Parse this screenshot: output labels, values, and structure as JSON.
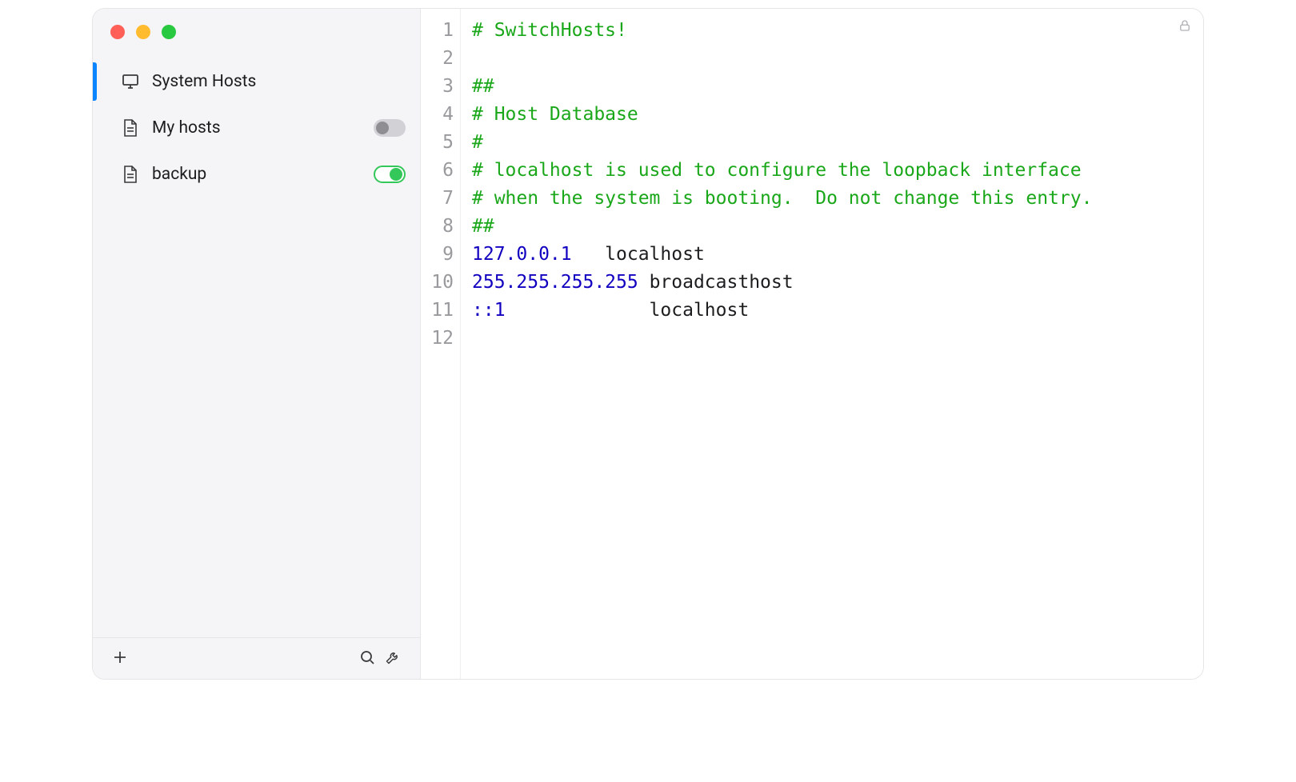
{
  "sidebar": {
    "items": [
      {
        "label": "System Hosts",
        "iconName": "monitor-icon",
        "selected": true,
        "toggle": null
      },
      {
        "label": "My hosts",
        "iconName": "file-icon",
        "selected": false,
        "toggle": "off"
      },
      {
        "label": "backup",
        "iconName": "file-icon",
        "selected": false,
        "toggle": "on"
      }
    ]
  },
  "editor": {
    "readOnly": true,
    "lines": [
      {
        "n": 1,
        "tokens": [
          {
            "t": "# SwitchHosts!",
            "c": "cm-comment"
          }
        ]
      },
      {
        "n": 2,
        "tokens": [
          {
            "t": "",
            "c": ""
          }
        ]
      },
      {
        "n": 3,
        "tokens": [
          {
            "t": "##",
            "c": "cm-comment"
          }
        ]
      },
      {
        "n": 4,
        "tokens": [
          {
            "t": "# Host Database",
            "c": "cm-comment"
          }
        ]
      },
      {
        "n": 5,
        "tokens": [
          {
            "t": "#",
            "c": "cm-comment"
          }
        ]
      },
      {
        "n": 6,
        "tokens": [
          {
            "t": "# localhost is used to configure the loopback interface",
            "c": "cm-comment"
          }
        ]
      },
      {
        "n": 7,
        "tokens": [
          {
            "t": "# when the system is booting.  Do not change this entry.",
            "c": "cm-comment"
          }
        ]
      },
      {
        "n": 8,
        "tokens": [
          {
            "t": "##",
            "c": "cm-comment"
          }
        ]
      },
      {
        "n": 9,
        "tokens": [
          {
            "t": "127.0.0.1",
            "c": "cm-ip"
          },
          {
            "t": "   localhost",
            "c": ""
          }
        ]
      },
      {
        "n": 10,
        "tokens": [
          {
            "t": "255.255.255.255",
            "c": "cm-ip"
          },
          {
            "t": " broadcasthost",
            "c": ""
          }
        ]
      },
      {
        "n": 11,
        "tokens": [
          {
            "t": "::1",
            "c": "cm-ip"
          },
          {
            "t": "             localhost",
            "c": ""
          }
        ]
      },
      {
        "n": 12,
        "tokens": [
          {
            "t": "",
            "c": ""
          }
        ]
      }
    ]
  }
}
